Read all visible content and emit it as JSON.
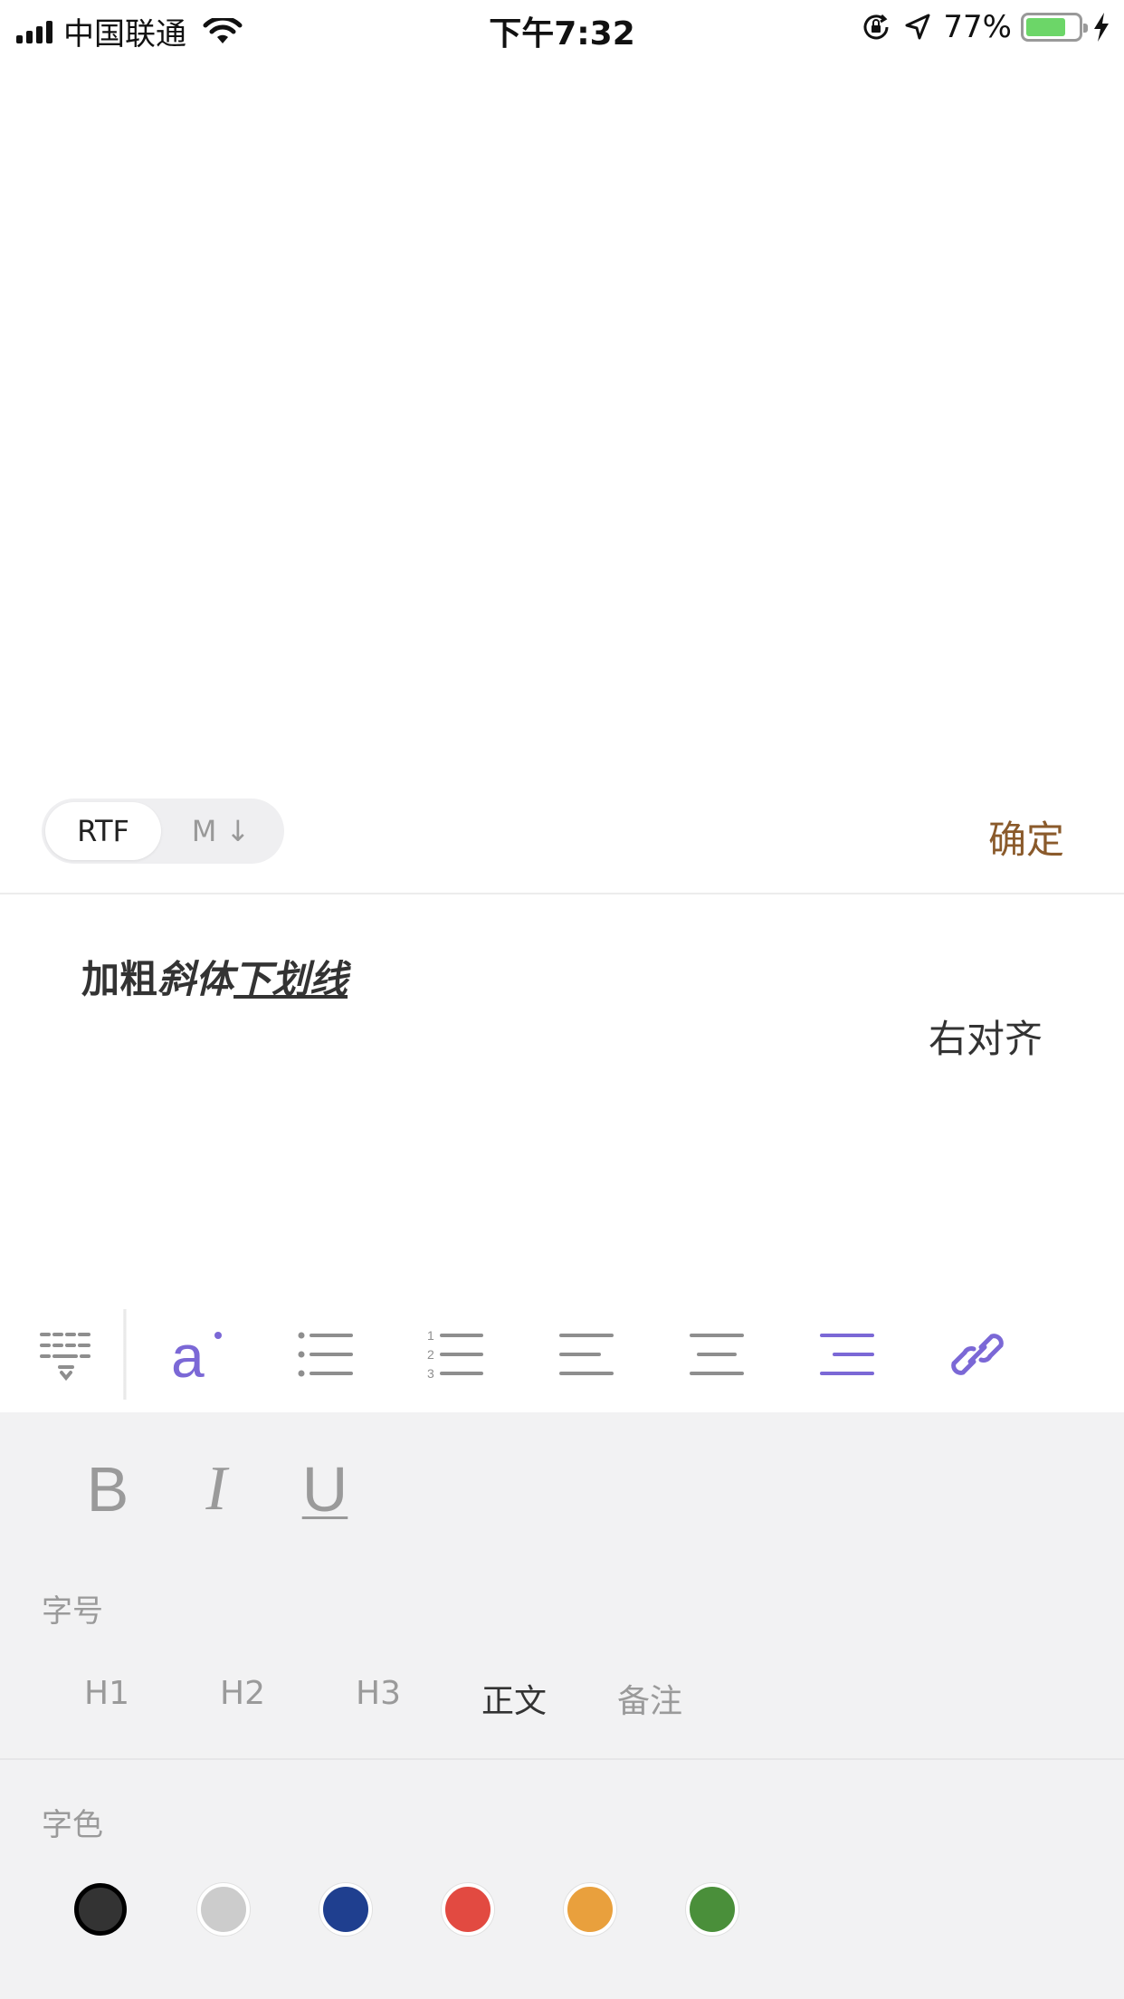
{
  "status_bar": {
    "carrier": "中国联通",
    "time": "下午7:32",
    "battery_percent": "77%",
    "battery_level": 0.77,
    "icons": [
      "signal-icon",
      "wifi-icon",
      "orientation-lock-icon",
      "location-arrow-icon",
      "battery-icon",
      "charging-bolt-icon"
    ]
  },
  "mode_bar": {
    "rtf_label": "RTF",
    "markdown_label": "M ↓",
    "confirm_label": "确定"
  },
  "editor": {
    "bold_text": "加粗",
    "italic_text": "斜体",
    "underline_text": "下划线",
    "right_aligned_text": "右对齐"
  },
  "toolbar": {
    "items": [
      "keyboard-icon",
      "text-style-icon",
      "bullet-list-icon",
      "numbered-list-icon",
      "align-left-icon",
      "align-center-icon",
      "align-right-icon",
      "link-icon"
    ],
    "active_color": "#7b68d6",
    "inactive_color": "#8e8e8e"
  },
  "format_panel": {
    "bold_label": "B",
    "italic_label": "I",
    "underline_label": "U",
    "font_size_label": "字号",
    "font_sizes": [
      "H1",
      "H2",
      "H3",
      "正文",
      "备注"
    ],
    "selected_font_size": "正文",
    "font_color_label": "字色",
    "colors": [
      "#333333",
      "#cccccc",
      "#1f3f8f",
      "#e24a41",
      "#e9a03d",
      "#4a8f3a"
    ],
    "selected_color": "#333333"
  }
}
